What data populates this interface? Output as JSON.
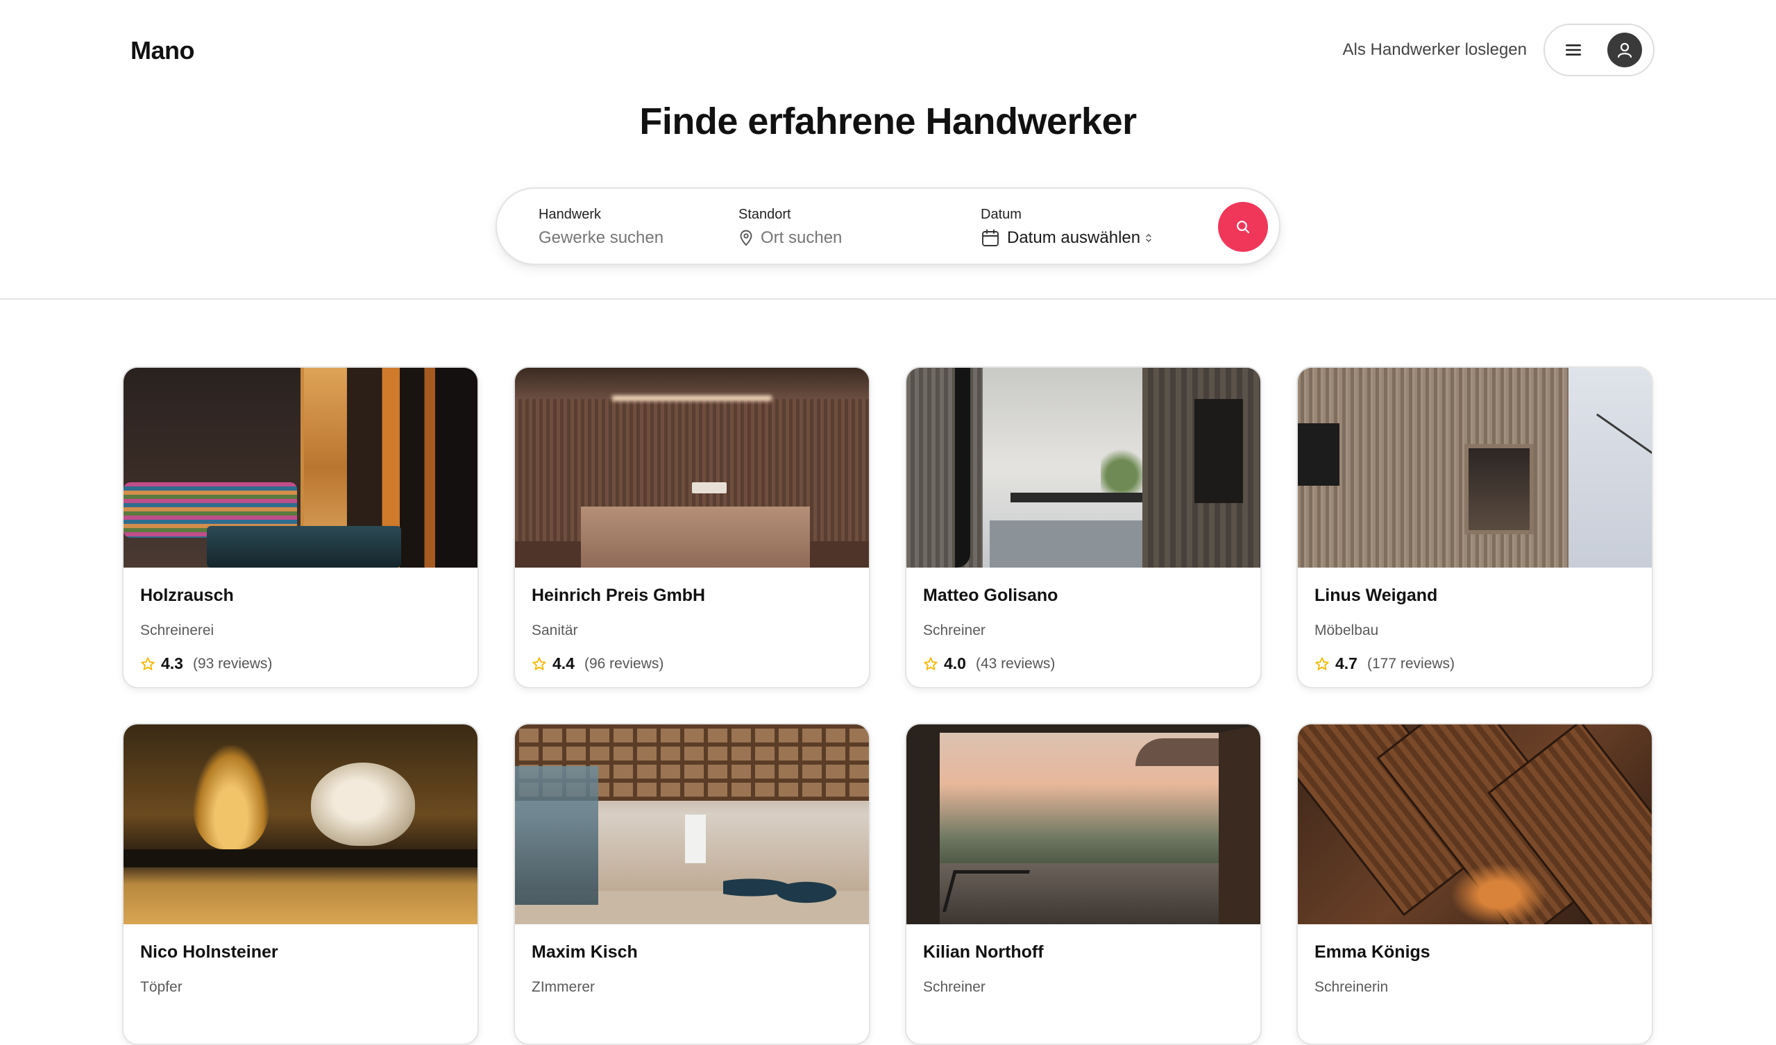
{
  "app": {
    "logo": "Mano",
    "become_pro_link": "Als Handwerker loslegen",
    "user_menu": {
      "menu_icon": "hamburger-icon",
      "avatar_icon": "user-icon"
    }
  },
  "hero": {
    "title": "Finde erfahrene Handwerker"
  },
  "search": {
    "craft": {
      "label": "Handwerk",
      "placeholder": "Gewerke suchen",
      "value": ""
    },
    "location": {
      "label": "Standort",
      "placeholder": "Ort suchen",
      "value": "",
      "icon": "map-pin-icon"
    },
    "date": {
      "label": "Datum",
      "value": "Datum auswählen",
      "icon": "calendar-icon",
      "chevron_icon": "updown-chevron-icon"
    },
    "button_icon": "search-icon",
    "button_color": "#f0375a"
  },
  "cards": [
    {
      "name": "Holzrausch",
      "trade": "Schreinerei",
      "rating": "4.3",
      "reviews": "(93 reviews)"
    },
    {
      "name": "Heinrich Preis GmbH",
      "trade": "Sanitär",
      "rating": "4.4",
      "reviews": "(96 reviews)"
    },
    {
      "name": "Matteo Golisano",
      "trade": "Schreiner",
      "rating": "4.0",
      "reviews": "(43 reviews)"
    },
    {
      "name": "Linus Weigand",
      "trade": "Möbelbau",
      "rating": "4.7",
      "reviews": "(177 reviews)"
    },
    {
      "name": "Nico Holnsteiner",
      "trade": "Töpfer",
      "rating": "",
      "reviews": ""
    },
    {
      "name": "Maxim Kisch",
      "trade": "ZImmerer",
      "rating": "",
      "reviews": ""
    },
    {
      "name": "Kilian Northoff",
      "trade": "Schreiner",
      "rating": "",
      "reviews": ""
    },
    {
      "name": "Emma Königs",
      "trade": "Schreinerin",
      "rating": "",
      "reviews": ""
    }
  ],
  "colors": {
    "star": "#f5b800",
    "accent": "#f0375a",
    "border": "#e4e4e4"
  }
}
